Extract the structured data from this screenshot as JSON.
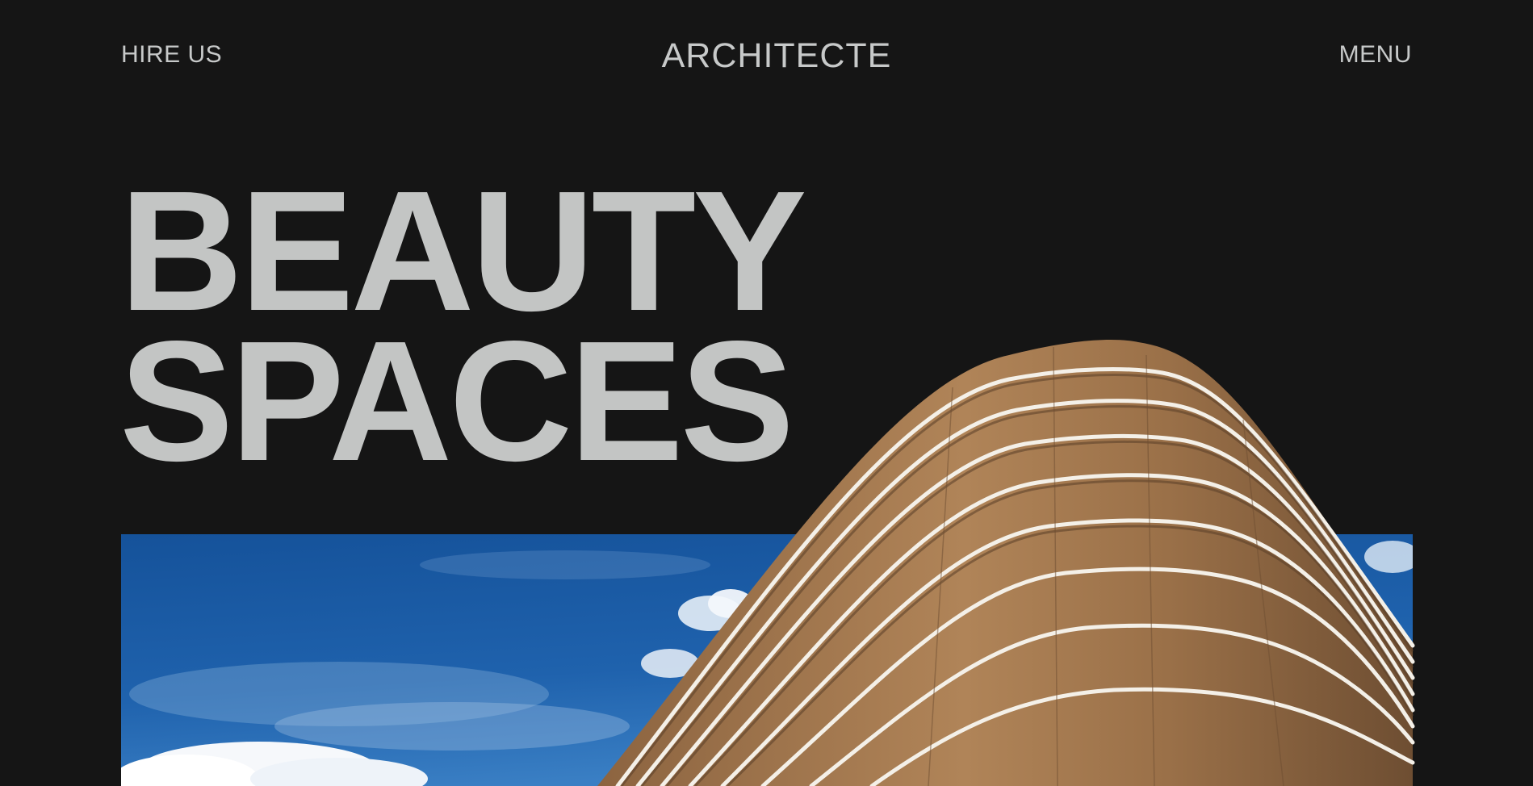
{
  "header": {
    "hire_label": "HIRE US",
    "logo": "ARCHITECTE",
    "menu_label": "MENU"
  },
  "hero": {
    "line1": "BEAUTY",
    "line2": "SPACES",
    "image": "curved-building-photo",
    "colors": {
      "background": "#151515",
      "text": "#c3c5c4",
      "sky": "#1e5aa0",
      "facade": "#a07650",
      "balcony_edge": "#f2efe8"
    }
  }
}
